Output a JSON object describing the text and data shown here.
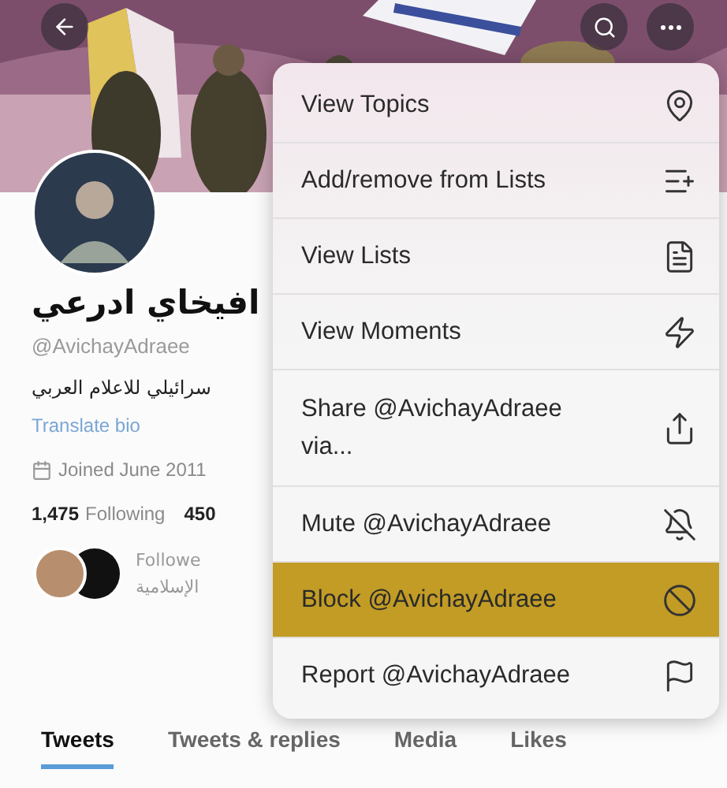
{
  "profile": {
    "name": "افيخاي ادرعي",
    "handle": "@AvichayAdraee",
    "bio": "سرائيلي للاعلام العربي",
    "translate": "Translate bio",
    "joined": "Joined June 2011",
    "following_count": "1,475",
    "following_label": "Following",
    "followers_count": "450",
    "followed_by": [
      "Followe",
      "الإسلامية"
    ]
  },
  "menu": [
    {
      "label": "View Topics",
      "highlighted": false
    },
    {
      "label": "Add/remove from Lists",
      "highlighted": false
    },
    {
      "label": "View Lists",
      "highlighted": false
    },
    {
      "label": "View Moments",
      "highlighted": false
    },
    {
      "label": "Share @AvichayAdraee via...",
      "highlighted": false
    },
    {
      "label": "Mute @AvichayAdraee",
      "highlighted": false
    },
    {
      "label": "Block @AvichayAdraee",
      "highlighted": true
    },
    {
      "label": "Report @AvichayAdraee",
      "highlighted": false
    }
  ],
  "tabs": [
    {
      "label": "Tweets",
      "selected": true
    },
    {
      "label": "Tweets & replies",
      "selected": false
    },
    {
      "label": "Media",
      "selected": false
    },
    {
      "label": "Likes",
      "selected": false
    }
  ]
}
